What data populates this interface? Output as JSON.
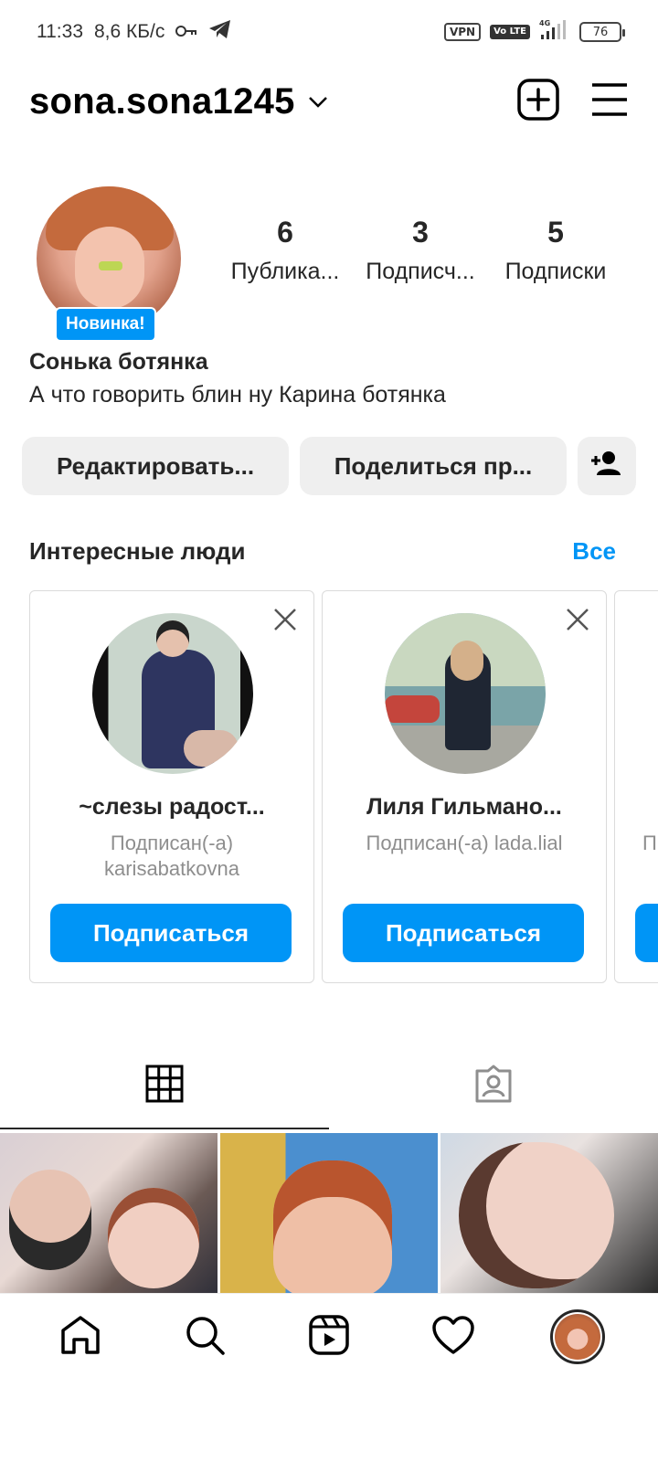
{
  "status_bar": {
    "time": "11:33",
    "speed": "8,6 КБ/с",
    "vpn": "VPN",
    "volte": "Vo LTE",
    "network": "4G",
    "battery": "76"
  },
  "header": {
    "username": "sona.sona1245"
  },
  "profile": {
    "new_badge": "Новинка!",
    "stats": [
      {
        "num": "6",
        "label": "Публика..."
      },
      {
        "num": "3",
        "label": "Подписч..."
      },
      {
        "num": "5",
        "label": "Подписки"
      }
    ],
    "name": "Сонька ботянка",
    "bio": "А что говорить блин ну Карина ботянка"
  },
  "buttons": {
    "edit": "Редактировать...",
    "share": "Поделиться пр..."
  },
  "suggestions": {
    "title": "Интересные люди",
    "all": "Все",
    "cards": [
      {
        "name": "~слезы радост...",
        "sub": "Подписан(-а) karisabatkovna",
        "follow": "Подписаться"
      },
      {
        "name": "Лиля Гильмано...",
        "sub": "Подписан(-а) lada.lial",
        "follow": "Подписаться"
      },
      {
        "name": "",
        "sub": "П",
        "follow": ""
      }
    ]
  },
  "colors": {
    "accent": "#0095f6",
    "text": "#262626",
    "secondary": "#8e8e8e",
    "pill_bg": "#efefef"
  },
  "icons": {
    "header": [
      "chevron-down-icon",
      "new-post-icon",
      "menu-icon"
    ],
    "tabs": [
      "grid-icon",
      "tagged-icon"
    ],
    "nav": [
      "home-icon",
      "search-icon",
      "reels-icon",
      "heart-icon",
      "profile-avatar"
    ]
  }
}
